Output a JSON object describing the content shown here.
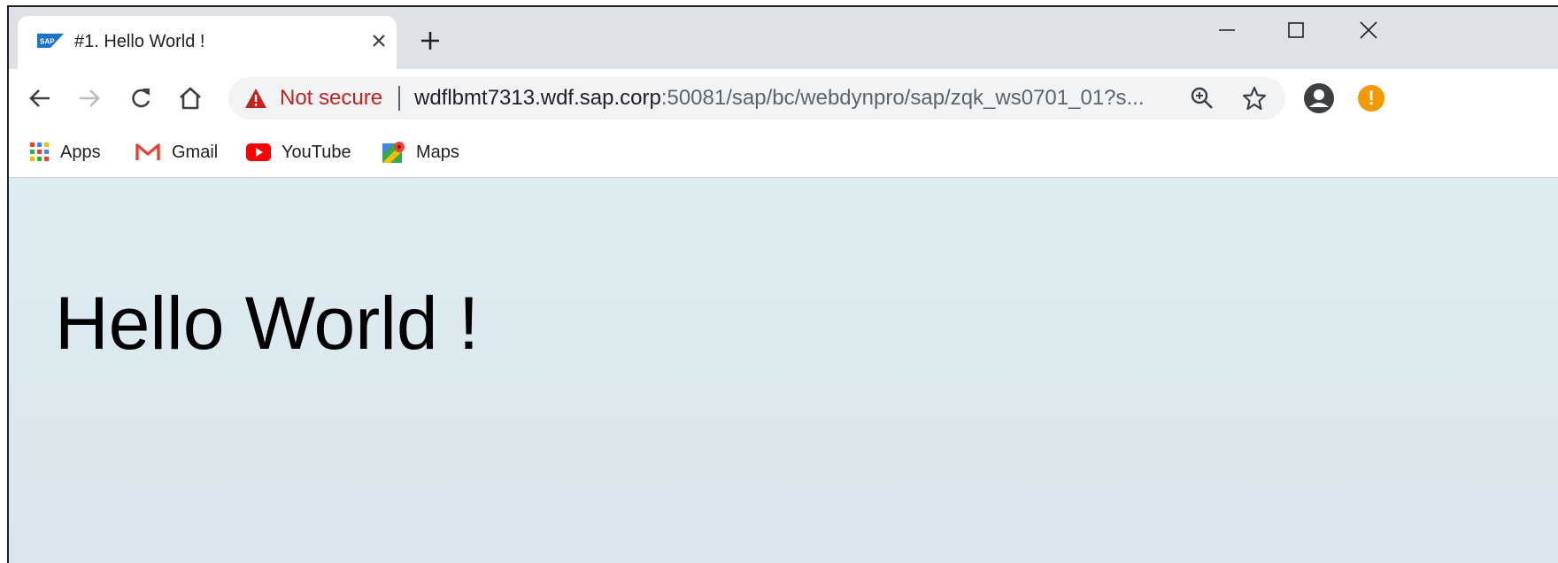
{
  "tab": {
    "title": "#1. Hello World !",
    "favicon": "sap-logo-icon"
  },
  "omnibox": {
    "security_label": "Not secure",
    "host": "wdflbmt7313.wdf.sap.corp",
    "path": ":50081/sap/bc/webdynpro/sap/zqk_ws0701_01?s..."
  },
  "bookmarks": [
    {
      "label": "Apps",
      "icon": "apps-grid-icon"
    },
    {
      "label": "Gmail",
      "icon": "gmail-icon"
    },
    {
      "label": "YouTube",
      "icon": "youtube-icon"
    },
    {
      "label": "Maps",
      "icon": "maps-icon"
    }
  ],
  "page": {
    "heading": "Hello World !"
  },
  "colors": {
    "tabstrip": "#dee1e6",
    "warning": "#c5221f",
    "alert": "#f29900",
    "content_bg": "#dcedf0"
  }
}
